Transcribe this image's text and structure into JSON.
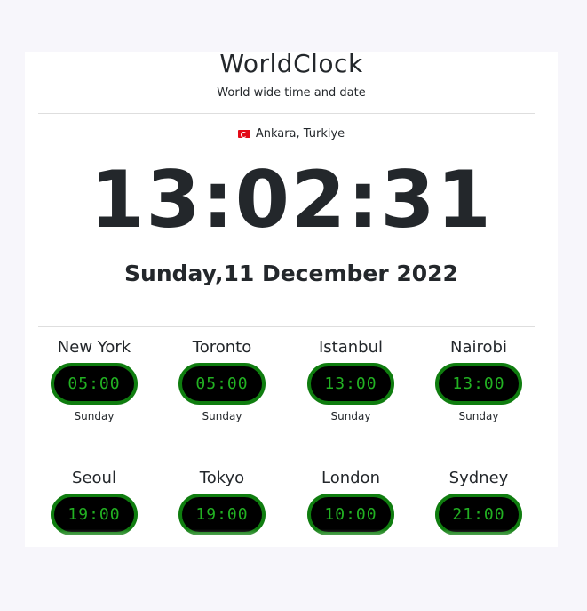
{
  "header": {
    "title": "WorldClock",
    "subtitle": "World wide time and date"
  },
  "location": {
    "flag_icon": "turkey-flag-icon",
    "label": "Ankara, Turkiye"
  },
  "main_clock": {
    "time": "13:02:31",
    "date": "Sunday,11 December 2022"
  },
  "colors": {
    "pill_border": "#0f7d0f",
    "pill_text": "#22b122",
    "pill_bg": "#000000"
  },
  "cities": [
    {
      "name": "New York",
      "time": "05:00",
      "day": "Sunday"
    },
    {
      "name": "Toronto",
      "time": "05:00",
      "day": "Sunday"
    },
    {
      "name": "Istanbul",
      "time": "13:00",
      "day": "Sunday"
    },
    {
      "name": "Nairobi",
      "time": "13:00",
      "day": "Sunday"
    },
    {
      "name": "Seoul",
      "time": "19:00",
      "day": ""
    },
    {
      "name": "Tokyo",
      "time": "19:00",
      "day": ""
    },
    {
      "name": "London",
      "time": "10:00",
      "day": ""
    },
    {
      "name": "Sydney",
      "time": "21:00",
      "day": ""
    }
  ]
}
